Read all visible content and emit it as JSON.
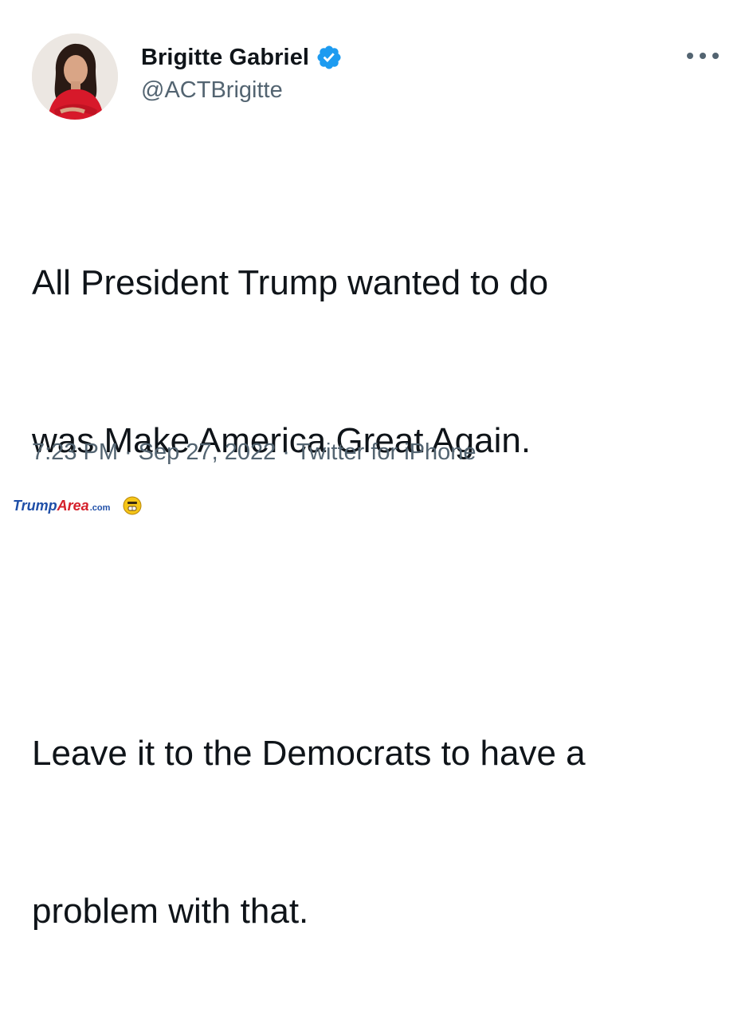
{
  "tweet": {
    "author": {
      "display_name": "Brigitte Gabriel",
      "handle": "@ACTBrigitte",
      "verified": true,
      "avatar_icon": "profile-photo"
    },
    "text_lines": [
      "All President Trump wanted to do",
      "was Make America Great Again.",
      "Leave it to the Democrats to have a",
      "problem with that."
    ],
    "time": "7:23 PM",
    "date": "Sep 27, 2022",
    "source": "Twitter for iPhone",
    "separator": "·",
    "more_icon": "ellipsis-icon"
  },
  "watermark": {
    "part1": "Trump",
    "part2": "Area",
    "part3": ".com"
  },
  "colors": {
    "text_primary": "#0f1419",
    "text_secondary": "#536471",
    "verified_blue": "#1d9bf0",
    "watermark_blue": "#1f4fa8",
    "watermark_red": "#d5202a"
  }
}
